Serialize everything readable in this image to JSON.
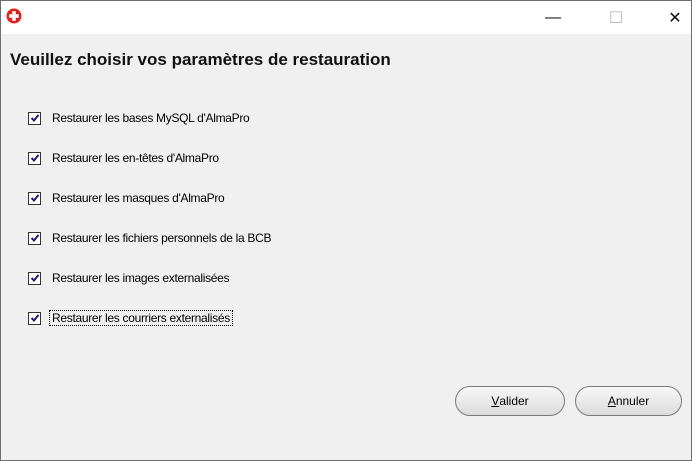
{
  "window": {
    "app_icon": "red-cross-icon",
    "controls": [
      "minimize-icon",
      "maximize-icon",
      "close-icon"
    ],
    "minimize_glyph": "—",
    "maximize_glyph": "☐",
    "close_glyph": "✕"
  },
  "heading": "Veuillez choisir vos paramètres de restauration",
  "options": [
    {
      "label": "Restaurer les bases MySQL d'AlmaPro",
      "checked": true
    },
    {
      "label": "Restaurer les en-têtes d'AlmaPro",
      "checked": true
    },
    {
      "label": "Restaurer les masques d'AlmaPro",
      "checked": true
    },
    {
      "label": "Restaurer les fichiers personnels de la BCB",
      "checked": true
    },
    {
      "label": "Restaurer les images externalisées",
      "checked": true
    },
    {
      "label": "Restaurer les courriers externalisés",
      "checked": true
    }
  ],
  "buttons": {
    "validate_first": "V",
    "validate_rest": "alider",
    "cancel_first": "A",
    "cancel_rest": "nnuler"
  },
  "colors": {
    "app_icon_red": "#e0201c",
    "check_color": "#1f1f6e"
  }
}
